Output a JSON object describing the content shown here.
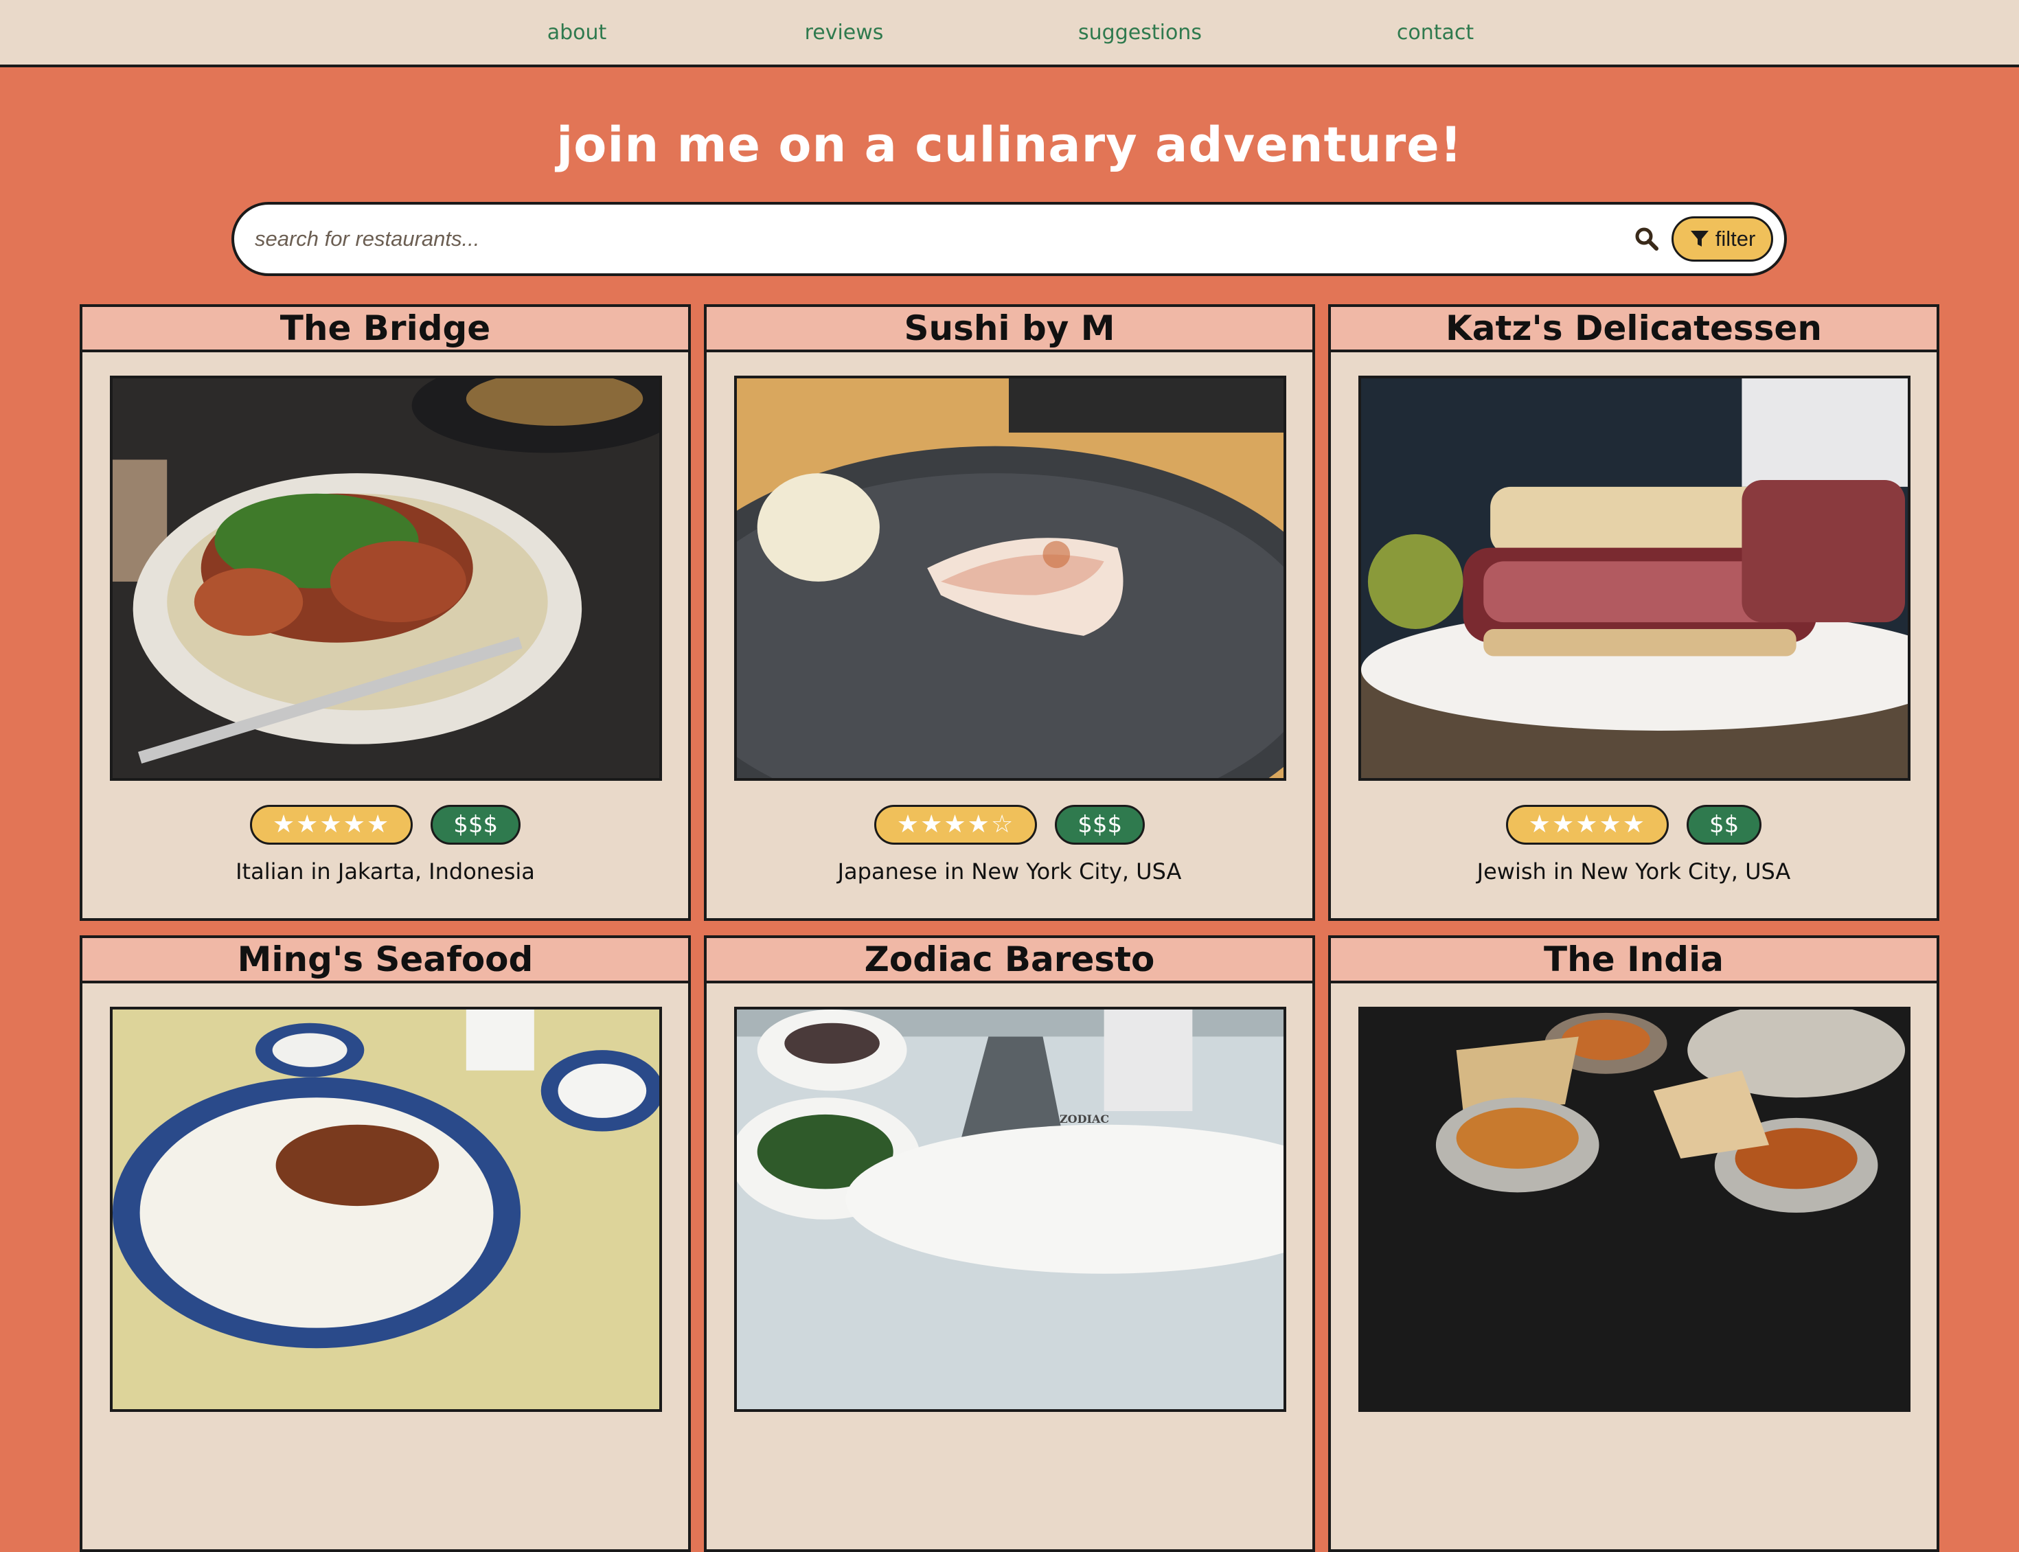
{
  "nav": {
    "about": "about",
    "reviews": "reviews",
    "suggestions": "suggestions",
    "contact": "contact"
  },
  "hero": {
    "title": "join me on a culinary adventure!"
  },
  "search": {
    "placeholder": "search for restaurants...",
    "filter_label": "filter",
    "icon": "search-icon",
    "filter_icon": "filter-icon"
  },
  "colors": {
    "background": "#e27556",
    "nav_bg": "#e9d9c9",
    "nav_link": "#2f7a4e",
    "card_bg": "#e9d9c9",
    "card_title_bg": "#f0b8a6",
    "stars_bg": "#f0c05a",
    "price_bg": "#2f7a4e"
  },
  "cards": [
    {
      "name": "The Bridge",
      "rating": "★★★★★",
      "rating_value": 5,
      "price": "$$$",
      "subtitle": "Italian in Jakarta, Indonesia",
      "photo": "lobster pasta"
    },
    {
      "name": "Sushi by M",
      "rating": "★★★★☆",
      "rating_value": 4,
      "price": "$$$",
      "subtitle": "Japanese in New York City, USA",
      "photo": "nigiri and ginger"
    },
    {
      "name": "Katz's Delicatessen",
      "rating": "★★★★★",
      "rating_value": 5,
      "price": "$$",
      "subtitle": "Jewish in New York City, USA",
      "photo": "pastrami sandwich"
    },
    {
      "name": "Ming's Seafood",
      "photo": "rice and seafood dishes"
    },
    {
      "name": "Zodiac Baresto",
      "photo": "bowls on a table",
      "photo_text": "ZODIAC"
    },
    {
      "name": "The India",
      "photo": "curries and naan"
    }
  ]
}
